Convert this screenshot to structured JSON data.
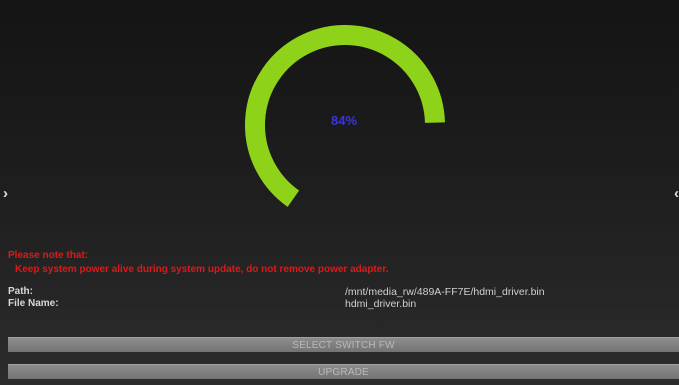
{
  "progress": {
    "percent": 84,
    "label": "84%",
    "color": "#8fd21a"
  },
  "warning": {
    "title": "Please note that:",
    "message": "Keep system power alive during system update, do not remove power adapter."
  },
  "info": {
    "path_label": "Path:",
    "path_value": "/mnt/media_rw/489A-FF7E/hdmi_driver.bin",
    "file_label": "File Name:",
    "file_value": "hdmi_driver.bin"
  },
  "buttons": {
    "select_switch_fw": "SELECT SWITCH FW",
    "upgrade": "UPGRADE"
  },
  "nav": {
    "left_icon": "chevron-left-icon",
    "right_icon": "chevron-right-icon"
  }
}
